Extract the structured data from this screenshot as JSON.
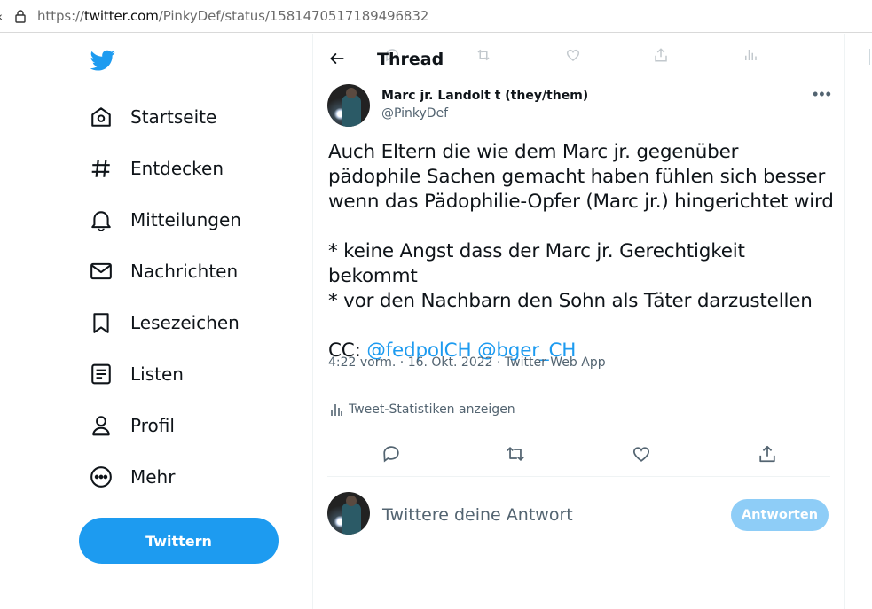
{
  "browser": {
    "url_prefix": "https://",
    "url_domain": "twitter.com",
    "url_path": "/PinkyDef/status/1581470517189496832"
  },
  "sidebar": {
    "items": [
      {
        "label": "Startseite",
        "icon": "home-icon"
      },
      {
        "label": "Entdecken",
        "icon": "hashtag-icon"
      },
      {
        "label": "Mitteilungen",
        "icon": "bell-icon"
      },
      {
        "label": "Nachrichten",
        "icon": "envelope-icon"
      },
      {
        "label": "Lesezeichen",
        "icon": "bookmark-icon"
      },
      {
        "label": "Listen",
        "icon": "list-icon"
      },
      {
        "label": "Profil",
        "icon": "person-icon"
      },
      {
        "label": "Mehr",
        "icon": "more-circle-icon"
      }
    ],
    "tweet_button": "Twittern"
  },
  "header": {
    "title": "Thread"
  },
  "tweet": {
    "author_name": "Marc jr. Landolt t (they/them)",
    "author_handle": "@PinkyDef",
    "text_main": "Auch Eltern die wie dem Marc jr. gegenüber pädophile Sachen gemacht haben fühlen sich besser wenn das Pädophilie-Opfer (Marc jr.) hingerichtet wird\n\n* keine Angst dass der Marc jr. Gerechtigkeit bekommt\n* vor den Nachbarn den Sohn als Täter darzustellen\n\n",
    "cc_prefix": "CC: ",
    "mention_1": "@fedpolCH",
    "mention_2": "@bger_CH",
    "meta": "4:22 vorm. · 16. Okt. 2022 · Twitter Web App",
    "stats_link": "Tweet-Statistiken anzeigen"
  },
  "reply": {
    "placeholder": "Twittere deine Antwort",
    "button": "Antworten"
  },
  "colors": {
    "accent": "#1d9bf0",
    "accent_disabled": "#8ecdf7",
    "muted_text": "#536471"
  }
}
